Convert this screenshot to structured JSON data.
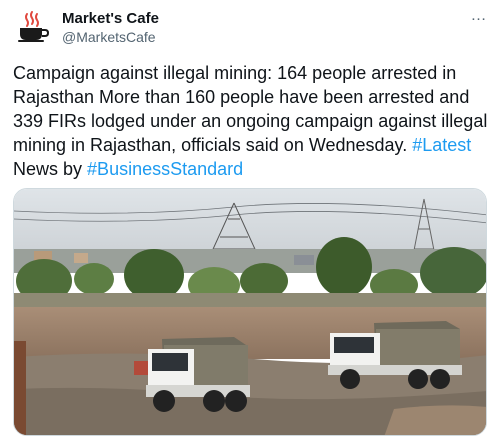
{
  "tweet": {
    "author_name": "Market's Cafe",
    "author_handle": "@MarketsCafe",
    "text_main": "Campaign against illegal mining: 164 people arrested in Rajasthan More than 160 people have been arrested and 339 FIRs lodged under an ongoing campaign against illegal mining in Rajasthan, officials said on Wednesday.",
    "hashtag_1": "#Latest",
    "text_mid": "News by",
    "hashtag_2": "#BusinessStandard",
    "more_icon": "…",
    "avatar_icon": "coffee-cup-icon",
    "colors": {
      "link": "#1d9bf0",
      "text": "#0f1419",
      "muted": "#536471"
    }
  },
  "media": {
    "subject": "photo-dump-trucks-quarry"
  }
}
